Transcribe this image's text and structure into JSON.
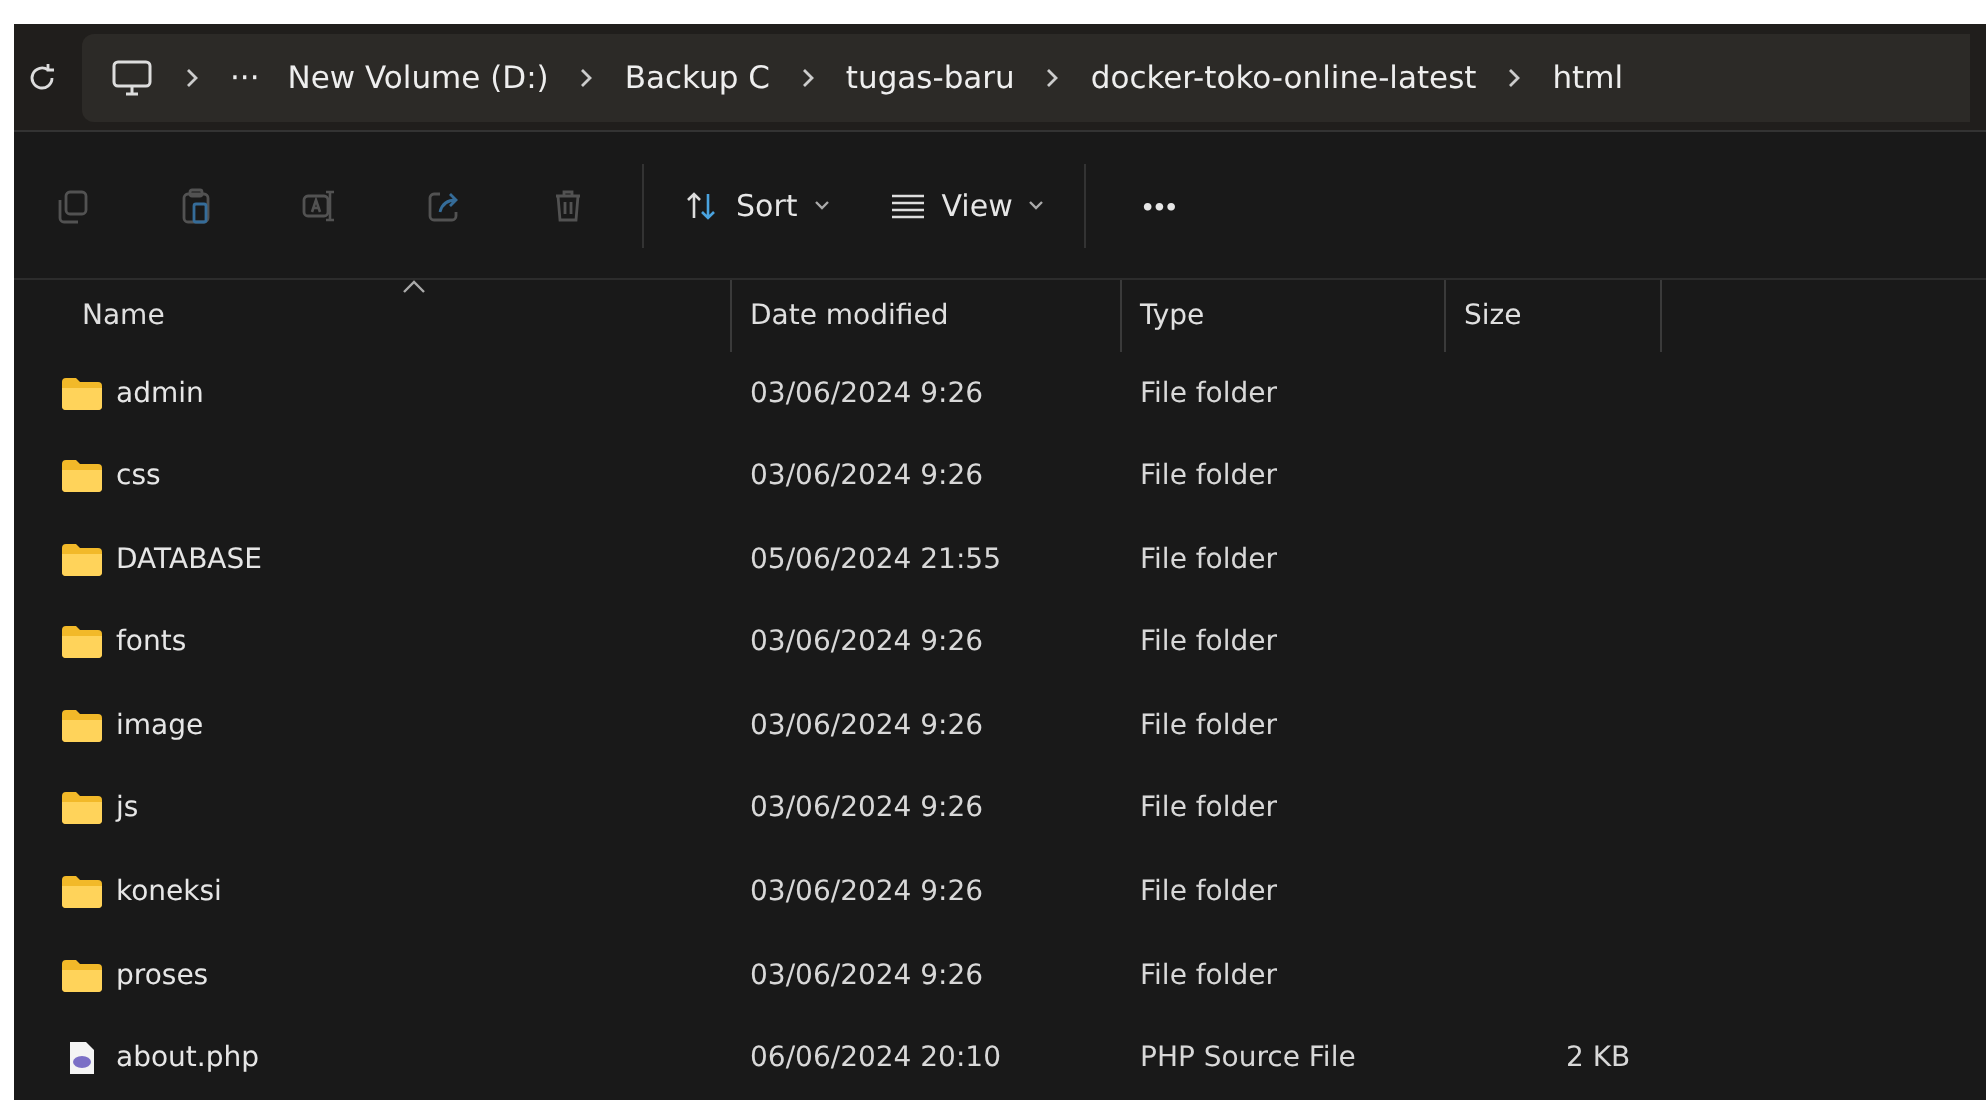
{
  "address_bar": {
    "more": "···",
    "path": [
      "New Volume (D:)",
      "Backup C",
      "tugas-baru",
      "docker-toko-online-latest",
      "html"
    ]
  },
  "toolbar": {
    "icon_buttons": [
      {
        "kind": "copy",
        "disabled": true
      },
      {
        "kind": "paste",
        "disabled": true
      },
      {
        "kind": "rename",
        "disabled": true
      },
      {
        "kind": "share",
        "disabled": true
      },
      {
        "kind": "delete",
        "disabled": true
      }
    ],
    "sort": "Sort",
    "view": "View",
    "more": "•••"
  },
  "columns": [
    "Name",
    "Date modified",
    "Type",
    "Size"
  ],
  "rows": [
    {
      "kind": "folder",
      "name": "admin",
      "date": "03/06/2024 9:26",
      "type": "File folder"
    },
    {
      "kind": "folder",
      "name": "css",
      "date": "03/06/2024 9:26",
      "type": "File folder"
    },
    {
      "kind": "folder",
      "name": "DATABASE",
      "date": "05/06/2024 21:55",
      "type": "File folder"
    },
    {
      "kind": "folder",
      "name": "fonts",
      "date": "03/06/2024 9:26",
      "type": "File folder"
    },
    {
      "kind": "folder",
      "name": "image",
      "date": "03/06/2024 9:26",
      "type": "File folder"
    },
    {
      "kind": "folder",
      "name": "js",
      "date": "03/06/2024 9:26",
      "type": "File folder"
    },
    {
      "kind": "folder",
      "name": "koneksi",
      "date": "03/06/2024 9:26",
      "type": "File folder"
    },
    {
      "kind": "folder",
      "name": "proses",
      "date": "03/06/2024 9:26",
      "type": "File folder"
    },
    {
      "kind": "php",
      "name": "about.php",
      "date": "06/06/2024 20:10",
      "type": "PHP Source File",
      "size": "2 KB"
    }
  ]
}
